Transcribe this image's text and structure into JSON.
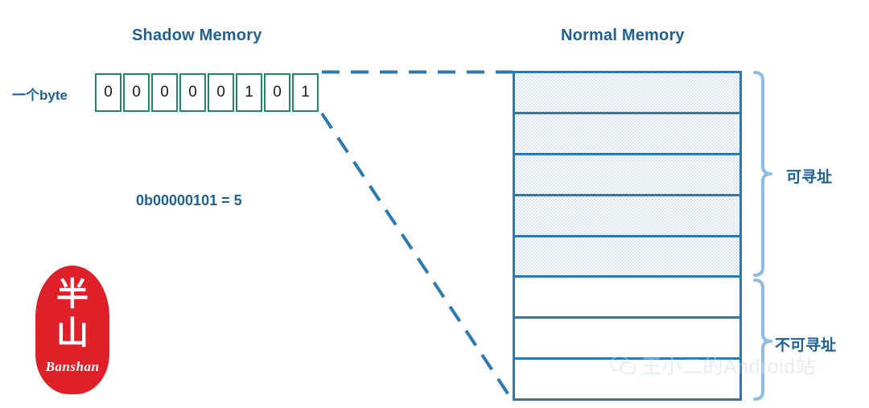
{
  "diagram": {
    "shadow_memory": {
      "title": "Shadow Memory",
      "byte_label": "一个byte",
      "bits": [
        "0",
        "0",
        "0",
        "0",
        "0",
        "1",
        "0",
        "1"
      ],
      "formula": "0b00000101 = 5"
    },
    "normal_memory": {
      "title": "Normal Memory",
      "rows": [
        {
          "fill": "shaded"
        },
        {
          "fill": "shaded"
        },
        {
          "fill": "shaded"
        },
        {
          "fill": "shaded"
        },
        {
          "fill": "shaded"
        },
        {
          "fill": "plain"
        },
        {
          "fill": "plain"
        },
        {
          "fill": "plain"
        }
      ],
      "braces": [
        {
          "label": "可寻址",
          "rows": 5
        },
        {
          "label": "不可寻址",
          "rows": 3
        }
      ]
    },
    "colors": {
      "title_blue": "#1f6192",
      "byte_border_green": "#1e8a63",
      "memory_border_blue": "#2a7ab0",
      "shaded_fill": "#dbe7f0",
      "brace_blue": "#8fbde2",
      "seal_red": "#e02028",
      "watermark_gray": "#d3dde6"
    },
    "connectors": [
      {
        "name": "top-dashed-connector",
        "style": "dashed"
      },
      {
        "name": "diagonal-dashed-connector",
        "style": "dashed"
      }
    ]
  },
  "seal": {
    "char_top": "半",
    "char_bottom": "山",
    "roman": "Banshan"
  },
  "watermark": {
    "icon": "wechat-icon",
    "text": "王小二的Android站"
  }
}
